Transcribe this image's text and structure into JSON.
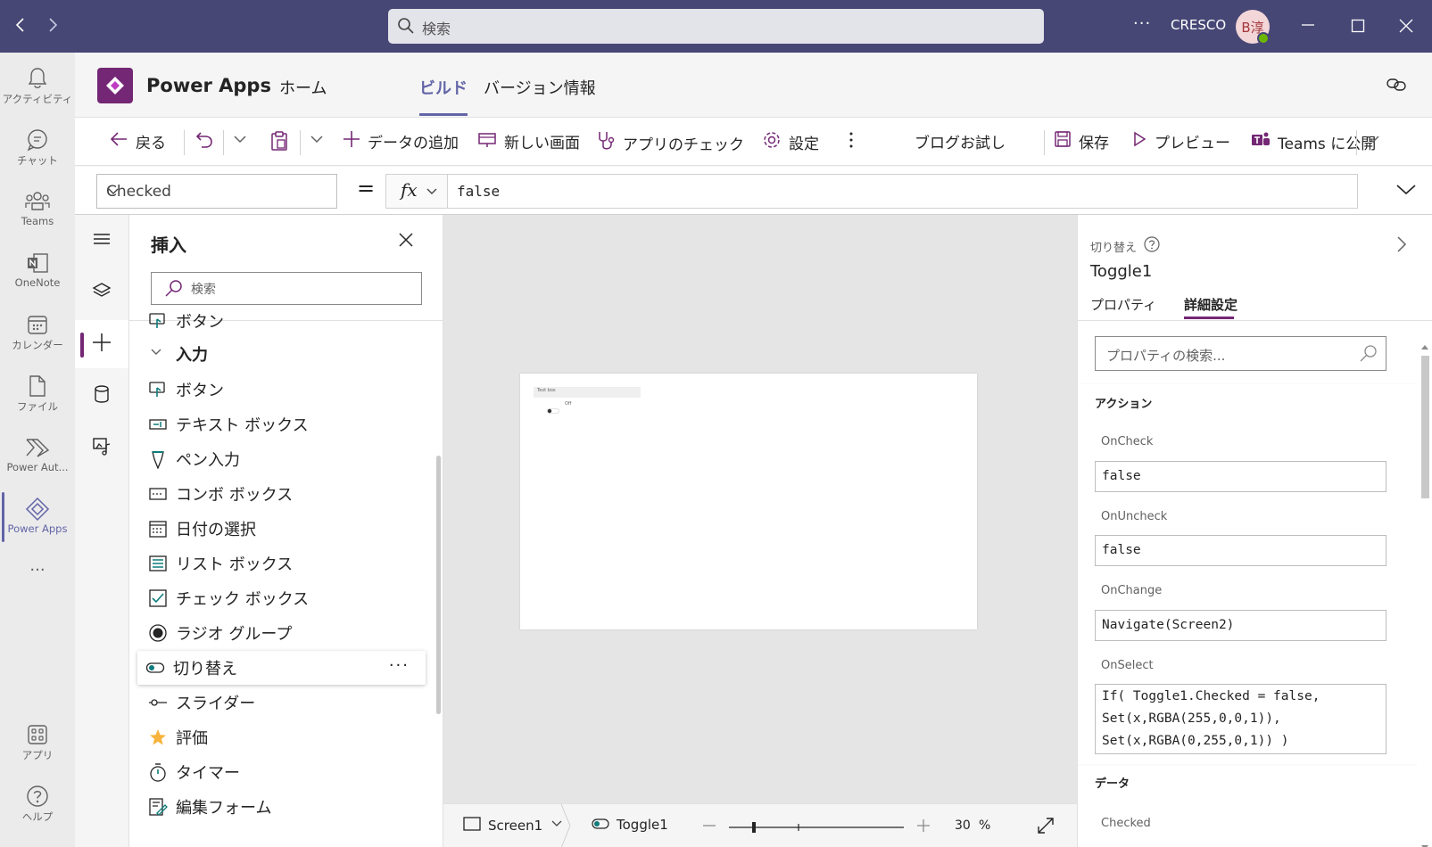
{
  "titlebar": {
    "search_placeholder": "検索",
    "more": "···",
    "org": "CRESCO",
    "avatar_initials": "B淳"
  },
  "rail": {
    "items": [
      {
        "label": "アクティビティ",
        "icon": "bell-icon"
      },
      {
        "label": "チャット",
        "icon": "chat-icon"
      },
      {
        "label": "Teams",
        "icon": "teams-icon"
      },
      {
        "label": "OneNote",
        "icon": "onenote-icon"
      },
      {
        "label": "カレンダー",
        "icon": "calendar-icon"
      },
      {
        "label": "ファイル",
        "icon": "file-icon"
      },
      {
        "label": "Power Aut...",
        "icon": "power-automate-icon"
      },
      {
        "label": "Power Apps",
        "icon": "power-apps-icon"
      }
    ],
    "more": "···",
    "apps": "アプリ",
    "help": "ヘルプ"
  },
  "app": {
    "name": "Power Apps",
    "tabs": [
      "ホーム",
      "ビルド",
      "バージョン情報"
    ],
    "active_tab": "ビルド"
  },
  "toolbar": {
    "back": "戻る",
    "add_data": "データの追加",
    "new_screen": "新しい画面",
    "app_checker": "アプリのチェック",
    "settings": "設定",
    "blog_try": "ブログお試し",
    "save": "保存",
    "preview": "プレビュー",
    "publish": "Teams に公開"
  },
  "formula_bar": {
    "property": "Checked",
    "equals": "=",
    "fx": "fx",
    "formula": "false"
  },
  "insert_panel": {
    "title": "挿入",
    "search_placeholder": "検索",
    "group_label": "入力",
    "partial_top_item": "ボタン",
    "items": [
      {
        "label": "ボタン",
        "icon": "button-icon"
      },
      {
        "label": "テキスト ボックス",
        "icon": "textbox-icon"
      },
      {
        "label": "ペン入力",
        "icon": "pen-icon"
      },
      {
        "label": "コンボ ボックス",
        "icon": "combobox-icon"
      },
      {
        "label": "日付の選択",
        "icon": "date-picker-icon"
      },
      {
        "label": "リスト ボックス",
        "icon": "listbox-icon"
      },
      {
        "label": "チェック ボックス",
        "icon": "checkbox-icon"
      },
      {
        "label": "ラジオ グループ",
        "icon": "radio-icon"
      },
      {
        "label": "切り替え",
        "icon": "toggle-icon",
        "selected": true
      },
      {
        "label": "スライダー",
        "icon": "slider-icon"
      },
      {
        "label": "評価",
        "icon": "star-icon"
      },
      {
        "label": "タイマー",
        "icon": "timer-icon"
      },
      {
        "label": "編集フォーム",
        "icon": "edit-form-icon"
      }
    ],
    "item_more": "···"
  },
  "canvas": {
    "textbox_label": "Text box",
    "toggle_label": "Off"
  },
  "statusbar": {
    "screen": "Screen1",
    "control": "Toggle1",
    "zoom_value": "30",
    "zoom_unit": "%"
  },
  "properties_panel": {
    "control_type": "切り替え",
    "control_name": "Toggle1",
    "tabs": [
      "プロパティ",
      "詳細設定"
    ],
    "active_tab": "詳細設定",
    "search_placeholder": "プロパティの検索...",
    "section_action": "アクション",
    "props": [
      {
        "name": "OnCheck",
        "value": "false"
      },
      {
        "name": "OnUncheck",
        "value": "false"
      },
      {
        "name": "OnChange",
        "value": "Navigate(Screen2)"
      },
      {
        "name": "OnSelect",
        "value": "If( Toggle1.Checked = false,\nSet(x,RGBA(255,0,0,1)),\nSet(x,RGBA(0,255,0,1)) )"
      }
    ],
    "section_data": "データ",
    "data_first_prop": "Checked"
  }
}
